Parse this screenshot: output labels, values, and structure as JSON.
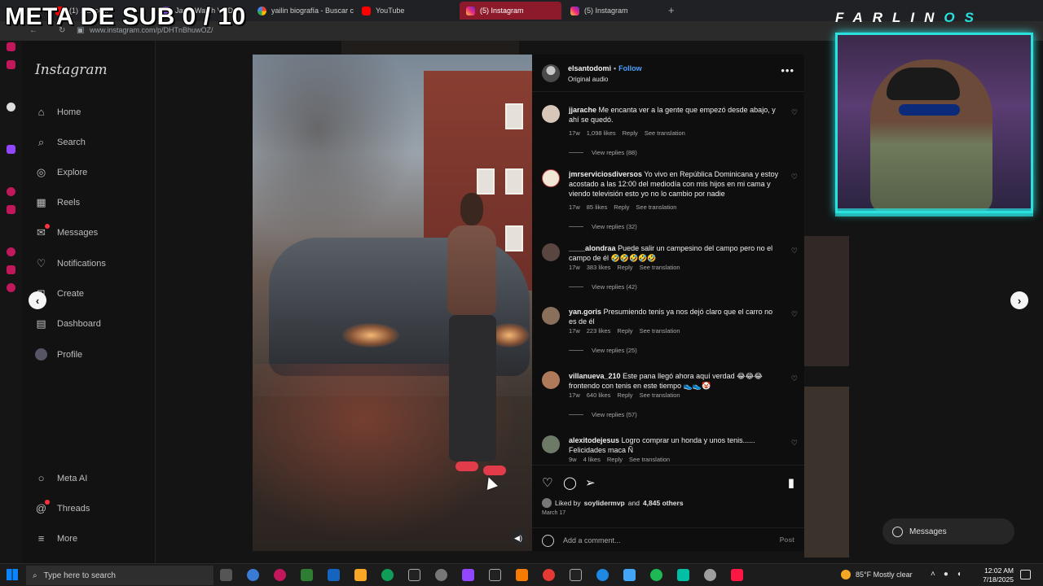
{
  "browser": {
    "tabs": [
      {
        "label": "(1) ...ance...",
        "favicon": "youtube-favicon",
        "active": false
      },
      {
        "label": "Javi - Watch VOD",
        "favicon": "twitch-favicon",
        "active": false
      },
      {
        "label": "yailin biografía - Buscar con Google",
        "favicon": "google-favicon",
        "active": false
      },
      {
        "label": "YouTube",
        "favicon": "youtube-favicon",
        "active": false
      },
      {
        "label": "(5) Instagram",
        "favicon": "instagram-favicon",
        "active": true
      },
      {
        "label": "(5) Instagram",
        "favicon": "instagram-favicon",
        "active": false
      }
    ],
    "new_tab": "+",
    "url": "www.instagram.com/p/DHTnBhuwOZ/"
  },
  "overlay": {
    "meta_sub": "META DE SUB  0 / 10",
    "streamer_name_main": "FARLIN",
    "streamer_name_accent": "OS"
  },
  "instagram": {
    "logo": "Instagram",
    "nav": [
      {
        "label": "Home",
        "icon": "home-icon"
      },
      {
        "label": "Search",
        "icon": "search-icon"
      },
      {
        "label": "Explore",
        "icon": "compass-icon"
      },
      {
        "label": "Reels",
        "icon": "reels-icon"
      },
      {
        "label": "Messages",
        "icon": "messenger-icon"
      },
      {
        "label": "Notifications",
        "icon": "heart-icon"
      },
      {
        "label": "Create",
        "icon": "plus-square-icon"
      },
      {
        "label": "Dashboard",
        "icon": "dashboard-icon"
      },
      {
        "label": "Profile",
        "icon": "profile-avatar"
      }
    ],
    "nav_bottom": [
      {
        "label": "Meta AI",
        "icon": "meta-ai-icon"
      },
      {
        "label": "Threads",
        "icon": "threads-icon"
      },
      {
        "label": "More",
        "icon": "menu-icon"
      }
    ],
    "post": {
      "author": "elsantodomi",
      "follow_label": "Follow",
      "audio": "Original audio",
      "more": "•••",
      "comments": [
        {
          "user": "jjarache",
          "text": "Me encanta ver a la gente que empezó desde abajo, y ahí se quedó.",
          "age": "17w",
          "likes": "1,098 likes",
          "reply": "Reply",
          "translate": "See translation",
          "replies": "View replies (88)"
        },
        {
          "user": "jmrserviciosdiversos",
          "text": "Yo vivo en República Dominicana y estoy acostado a las 12:00 del mediodía con mis hijos en mi cama y viendo televisión esto yo no lo cambio por nadie",
          "age": "17w",
          "likes": "85 likes",
          "reply": "Reply",
          "translate": "See translation",
          "replies": "View replies (32)"
        },
        {
          "user": "____alondraa",
          "text": "Puede salir un campesino del campo pero no el campo de él 🤣🤣🤣🤣🤣",
          "age": "17w",
          "likes": "383 likes",
          "reply": "Reply",
          "translate": "See translation",
          "replies": "View replies (42)"
        },
        {
          "user": "yan.goris",
          "text": "Presumiendo tenis ya nos dejó claro que el carro no es de él",
          "age": "17w",
          "likes": "223 likes",
          "reply": "Reply",
          "translate": "See translation",
          "replies": "View replies (25)"
        },
        {
          "user": "villanueva_210",
          "text": "Este pana llegó ahora aquí verdad 😂😂😂 frontendo con tenis en este tiempo 👟👟🤡",
          "age": "17w",
          "likes": "640 likes",
          "reply": "Reply",
          "translate": "See translation",
          "replies": "View replies (57)"
        },
        {
          "user": "alexitodejesus",
          "text": "Logro comprar un honda y unos tenis...... Felicidades maca Ñ",
          "age": "9w",
          "likes": "4 likes",
          "reply": "Reply",
          "translate": "See translation",
          "replies": ""
        }
      ],
      "liked_by_prefix": "Liked by",
      "liked_by_user": "soylidermvp",
      "liked_by_and": "and",
      "liked_by_others": "4,845 others",
      "date": "March 17",
      "add_comment_placeholder": "Add a comment...",
      "post_button": "Post"
    },
    "messages_pill": "Messages"
  },
  "taskbar": {
    "search_placeholder": "Type here to search",
    "weather": "85°F  Mostly clear",
    "time": "12:02 AM",
    "date": "7/18/2025"
  },
  "colors": {
    "accent_cyan": "#29e2e0",
    "instagram_follow": "#4ea1ff",
    "active_tab": "#8c1a2b"
  }
}
